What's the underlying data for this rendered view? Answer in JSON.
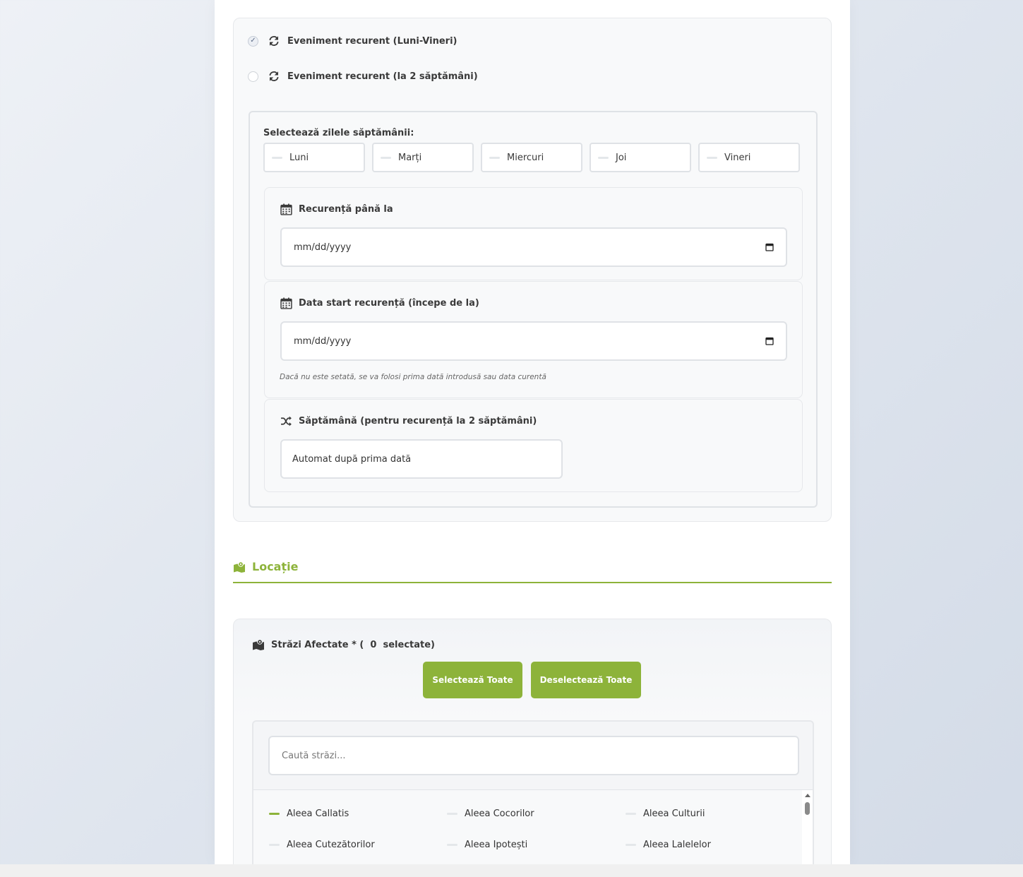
{
  "recurrence": {
    "option_weekdays": {
      "label": "Eveniment recurent (Luni-Vineri)",
      "checked": true
    },
    "option_biweekly": {
      "label": "Eveniment recurent (la 2 săptămâni)",
      "checked": false
    },
    "days_label": "Selectează zilele săptămânii:",
    "days": [
      "Luni",
      "Marți",
      "Miercuri",
      "Joi",
      "Vineri"
    ],
    "until": {
      "label": "Recurență până la",
      "placeholder": "mm/dd/yyyy",
      "icon": "calendar-icon"
    },
    "start": {
      "label": "Data start recurență (începe de la)",
      "placeholder": "mm/dd/yyyy",
      "hint": "Dacă nu este setată, se va folosi prima dată introdusă sau data curentă",
      "icon": "calendar-icon"
    },
    "week": {
      "label": "Săptămână (pentru recurență la 2 săptămâni)",
      "value": "Automat după prima dată",
      "icon": "shuffle-icon"
    }
  },
  "location": {
    "title": "Locație",
    "icon": "map-icon",
    "accent_color": "#8db33a"
  },
  "streets": {
    "label": "Străzi Afectate * (  0  selectate)",
    "selected_count": 0,
    "select_all": "Selectează Toate",
    "deselect_all": "Deselectează Toate",
    "search_placeholder": "Caută străzi...",
    "items": [
      {
        "name": "Aleea Callatis",
        "active": true
      },
      {
        "name": "Aleea Cocorilor",
        "active": false
      },
      {
        "name": "Aleea Culturii",
        "active": false
      },
      {
        "name": "Aleea Cutezătorilor",
        "active": false
      },
      {
        "name": "Aleea Ipotești",
        "active": false
      },
      {
        "name": "Aleea Lalelelor",
        "active": false
      }
    ]
  }
}
